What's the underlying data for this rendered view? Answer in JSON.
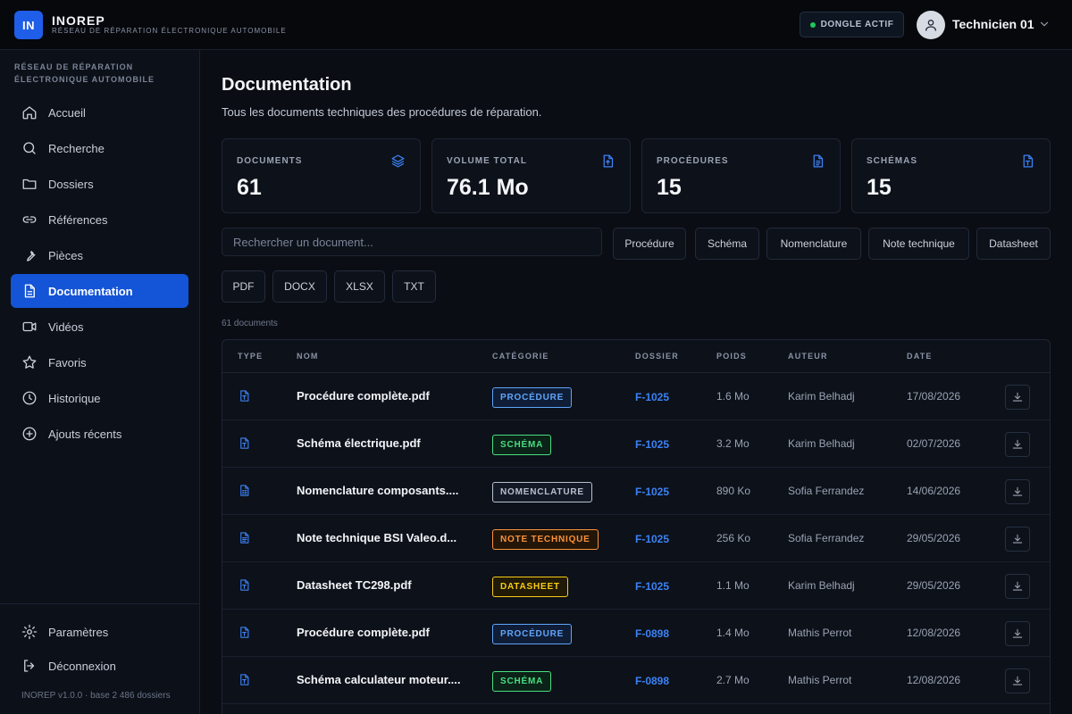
{
  "header": {
    "logo": "IN",
    "brand": "INOREP",
    "tagline": "RÉSEAU DE RÉPARATION ÉLECTRONIQUE AUTOMOBILE",
    "dongle": "DONGLE ACTIF",
    "user": "Technicien 01"
  },
  "sidebar": {
    "caption": "RÉSEAU DE RÉPARATION ÉLECTRONIQUE AUTOMOBILE",
    "items": [
      {
        "label": "Accueil",
        "icon": "home-icon"
      },
      {
        "label": "Recherche",
        "icon": "search-icon"
      },
      {
        "label": "Dossiers",
        "icon": "folder-icon"
      },
      {
        "label": "Références",
        "icon": "link-icon"
      },
      {
        "label": "Pièces",
        "icon": "wrench-icon"
      },
      {
        "label": "Documentation",
        "icon": "document-icon",
        "active": true
      },
      {
        "label": "Vidéos",
        "icon": "video-icon"
      },
      {
        "label": "Favoris",
        "icon": "star-icon"
      },
      {
        "label": "Historique",
        "icon": "clock-icon"
      },
      {
        "label": "Ajouts récents",
        "icon": "plus-circle-icon"
      }
    ],
    "settings": "Paramètres",
    "logout": "Déconnexion",
    "version": "INOREP v1.0.0 · base 2 486 dossiers"
  },
  "main": {
    "title": "Documentation",
    "subtitle": "Tous les documents techniques des procédures de réparation.",
    "stats": [
      {
        "label": "DOCUMENTS",
        "value": "61",
        "icon": "layers-icon"
      },
      {
        "label": "VOLUME TOTAL",
        "value": "76.1 Mo",
        "icon": "file-upload-icon"
      },
      {
        "label": "PROCÉDURES",
        "value": "15",
        "icon": "file-text-icon"
      },
      {
        "label": "SCHÉMAS",
        "value": "15",
        "icon": "file-type-icon"
      }
    ],
    "search_placeholder": "Rechercher un document...",
    "category_filters": [
      "Procédure",
      "Schéma",
      "Nomenclature",
      "Note technique",
      "Datasheet"
    ],
    "format_filters": [
      "PDF",
      "DOCX",
      "XLSX",
      "TXT"
    ],
    "count": "61 documents",
    "columns": [
      "TYPE",
      "NOM",
      "CATÉGORIE",
      "DOSSIER",
      "POIDS",
      "AUTEUR",
      "DATE"
    ],
    "rows": [
      {
        "icon": "file-type-icon",
        "name": "Procédure complète.pdf",
        "category": "PROCÉDURE",
        "kind": "proc",
        "dossier": "F-1025",
        "poids": "1.6 Mo",
        "auteur": "Karim Belhadj",
        "date": "17/08/2026"
      },
      {
        "icon": "file-type-icon",
        "name": "Schéma électrique.pdf",
        "category": "SCHÉMA",
        "kind": "sch",
        "dossier": "F-1025",
        "poids": "3.2 Mo",
        "auteur": "Karim Belhadj",
        "date": "02/07/2026"
      },
      {
        "icon": "spreadsheet-icon",
        "name": "Nomenclature composants....",
        "category": "NOMENCLATURE",
        "kind": "nom",
        "dossier": "F-1025",
        "poids": "890 Ko",
        "auteur": "Sofia Ferrandez",
        "date": "14/06/2026"
      },
      {
        "icon": "file-text-icon",
        "name": "Note technique BSI Valeo.d...",
        "category": "NOTE TECHNIQUE",
        "kind": "note",
        "dossier": "F-1025",
        "poids": "256 Ko",
        "auteur": "Sofia Ferrandez",
        "date": "29/05/2026"
      },
      {
        "icon": "file-type-icon",
        "name": "Datasheet TC298.pdf",
        "category": "DATASHEET",
        "kind": "data",
        "dossier": "F-1025",
        "poids": "1.1 Mo",
        "auteur": "Karim Belhadj",
        "date": "29/05/2026"
      },
      {
        "icon": "file-type-icon",
        "name": "Procédure complète.pdf",
        "category": "PROCÉDURE",
        "kind": "proc",
        "dossier": "F-0898",
        "poids": "1.4 Mo",
        "auteur": "Mathis Perrot",
        "date": "12/08/2026"
      },
      {
        "icon": "file-type-icon",
        "name": "Schéma calculateur moteur....",
        "category": "SCHÉMA",
        "kind": "sch",
        "dossier": "F-0898",
        "poids": "2.7 Mo",
        "auteur": "Mathis Perrot",
        "date": "12/08/2026"
      }
    ]
  },
  "colors": {
    "accent": "#1454d6",
    "link": "#3b82f6",
    "success": "#22c55e"
  }
}
